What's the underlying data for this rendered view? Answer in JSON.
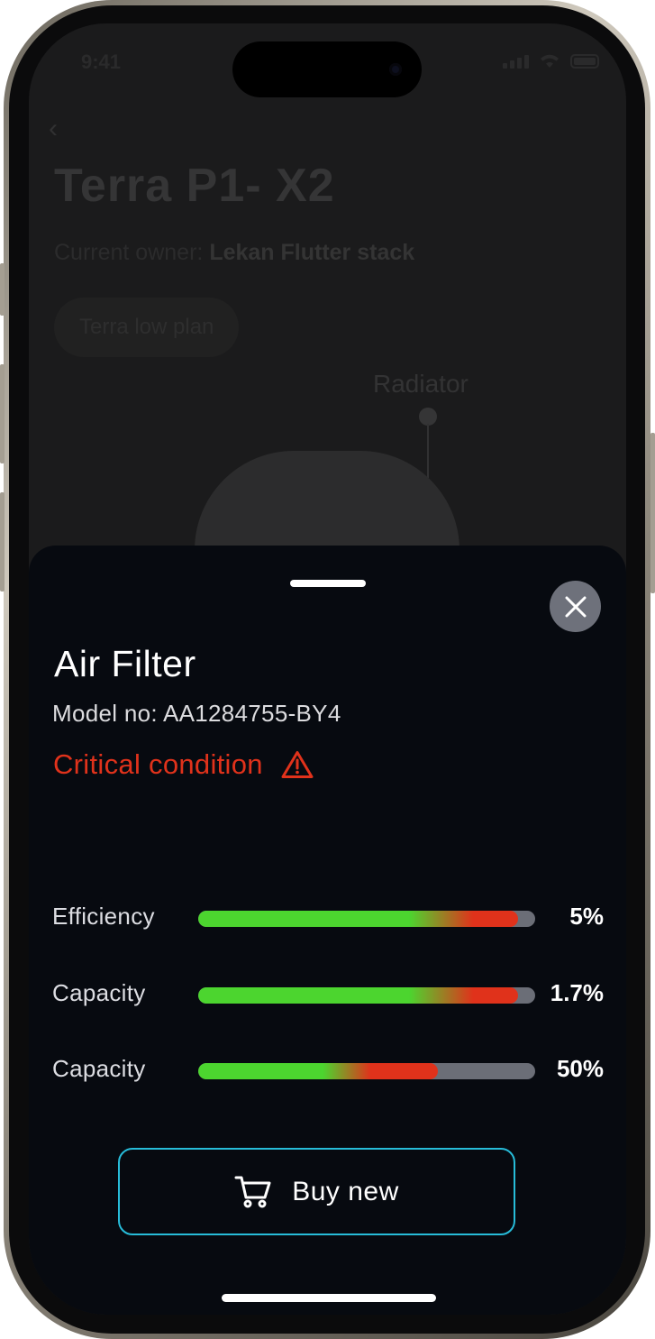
{
  "status_bar": {
    "time": "9:41"
  },
  "background": {
    "title": "Terra P1- X2",
    "owner_label": "Current owner:",
    "owner_name": "Lekan Flutter stack",
    "plan_chip": "Terra low plan",
    "radiator_label": "Radiator"
  },
  "sheet": {
    "title": "Air Filter",
    "model_no": "Model no: AA1284755-BY4",
    "condition": "Critical condition",
    "condition_color": "#e0321b",
    "metrics": [
      {
        "label": "Efficiency",
        "value": "5%",
        "fill_fraction": 0.95
      },
      {
        "label": "Capacity",
        "value": "1.7%",
        "fill_fraction": 0.95
      },
      {
        "label": "Capacity",
        "value": "50%",
        "fill_fraction": 0.71
      }
    ],
    "buy_button": {
      "label": "Buy new",
      "icon": "cart-icon"
    },
    "close_icon": "close-icon",
    "accent_color": "#27bcd9"
  }
}
